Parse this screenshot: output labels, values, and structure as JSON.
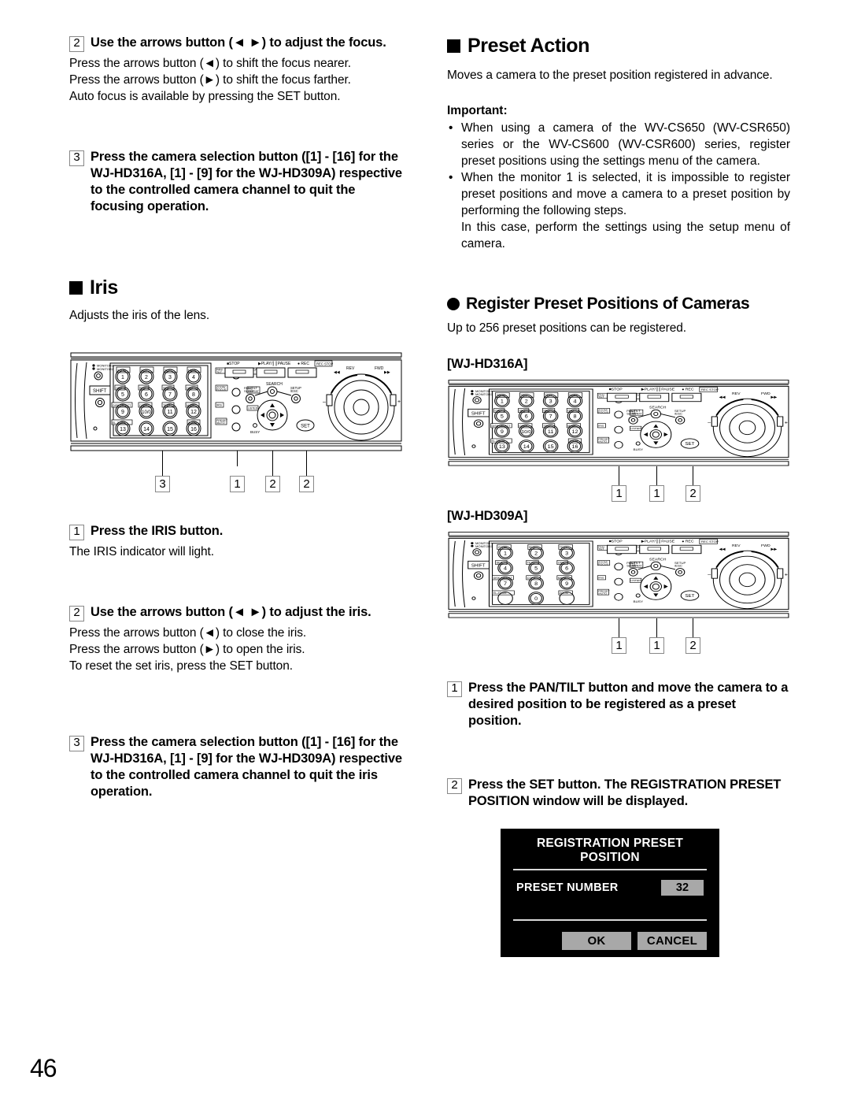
{
  "page": {
    "number": "46"
  },
  "left_column": {
    "step_focus_adjust": {
      "num": "2",
      "title": "Use the arrows button (◄ ►) to adjust the focus.",
      "lines": [
        "Press the arrows button (◄) to shift the focus nearer.",
        "Press the arrows button (►) to shift the focus farther.",
        "Auto focus is available by pressing the SET button."
      ]
    },
    "step_quit_focus": {
      "num": "3",
      "title": "Press the camera selection button ([1] - [16] for the WJ-HD316A, [1] - [9] for the WJ-HD309A) respective to the controlled camera channel to quit the focusing operation."
    },
    "iris_heading": "Iris",
    "iris_intro": "Adjusts the iris of the lens.",
    "iris_diagram_callouts": [
      "3",
      "1",
      "2",
      "2"
    ],
    "step_iris_button": {
      "num": "1",
      "title": "Press the IRIS button.",
      "lines": [
        "The IRIS indicator will light."
      ]
    },
    "step_iris_adjust": {
      "num": "2",
      "title": "Use the arrows button (◄ ►) to adjust the iris.",
      "lines": [
        "Press the arrows button (◄) to close the iris.",
        "Press the arrows button (►) to open the iris.",
        "To reset the set iris, press the SET button."
      ]
    },
    "step_quit_iris": {
      "num": "3",
      "title": "Press the camera selection button ([1] - [16] for the WJ-HD316A, [1] - [9] for the WJ-HD309A) respective to the controlled camera channel to quit the iris operation."
    }
  },
  "right_column": {
    "preset_action_heading": "Preset Action",
    "preset_action_intro": "Moves a camera to the preset position registered in advance.",
    "important_label": "Important:",
    "important_bullets": [
      "When using a camera of the WV-CS650 (WV-CSR650) series or the WV-CS600 (WV-CSR600) series, register preset positions using the settings menu of the camera.",
      "When the monitor 1 is selected, it is impossible to register preset positions and move a camera to a preset position by performing the following steps."
    ],
    "important_bullet2_sub": "In this case, perform the settings using the setup menu of camera.",
    "register_heading": "Register Preset Positions of Cameras",
    "register_intro": "Up to 256 preset positions can be registered.",
    "model_316": "[WJ-HD316A]",
    "model_309": "[WJ-HD309A]",
    "diagram_316_callouts": [
      "1",
      "1",
      "2"
    ],
    "diagram_309_callouts": [
      "1",
      "1",
      "2"
    ],
    "step_pantilt": {
      "num": "1",
      "title": "Press the PAN/TILT button and move the camera to a desired position to be registered as a preset position."
    },
    "step_set": {
      "num": "2",
      "title": "Press the SET button. The REGISTRATION PRESET POSITION window will be displayed."
    }
  },
  "osd": {
    "title": "REGISTRATION PRESET POSITION",
    "preset_number_label": "PRESET NUMBER",
    "preset_number_value": "32",
    "ok_label": "OK",
    "cancel_label": "CANCEL"
  },
  "panel_labels": {
    "monitor1": "MONITOR1",
    "monitor2": "MONITOR2",
    "shift": "SHIFT",
    "pan_tilt": "PAN/TILT",
    "zoom_focus": "ZOOM/FOCUS",
    "iris": "IRIS",
    "preset_auto": "PRESET/AUTO",
    "auto_seq": "AUTO/SEQ",
    "ab_repeat": "A-B REPEAT",
    "listed": "LISTED",
    "stop": "STOP",
    "play_pause": "PLAY/PAUSE",
    "rec": "REC",
    "rec_stop": "REC STOP",
    "search": "SEARCH",
    "pantilt_slow": "PAN/TILT SLOW",
    "setup_esc": "SETUP/ESC",
    "set": "SET",
    "busy": "BUSY",
    "rev": "REV",
    "fwd": "FWD",
    "disk_select": "DISK SELECT",
    "copy": "COPY",
    "text": "TEXT",
    "mark": "MARK",
    "el_zoom": "EL-ZOOM",
    "zoom": "ZOOM",
    "seq": "SEQ",
    "osd": "OSD",
    "keys_316": [
      "1",
      "2",
      "3",
      "4",
      "5",
      "6",
      "7",
      "8",
      "9",
      "10/0",
      "11",
      "12",
      "13",
      "14",
      "15",
      "16"
    ],
    "keys_309": [
      "1",
      "2",
      "3",
      "4",
      "5",
      "6",
      "7",
      "8",
      "9",
      "0"
    ]
  }
}
